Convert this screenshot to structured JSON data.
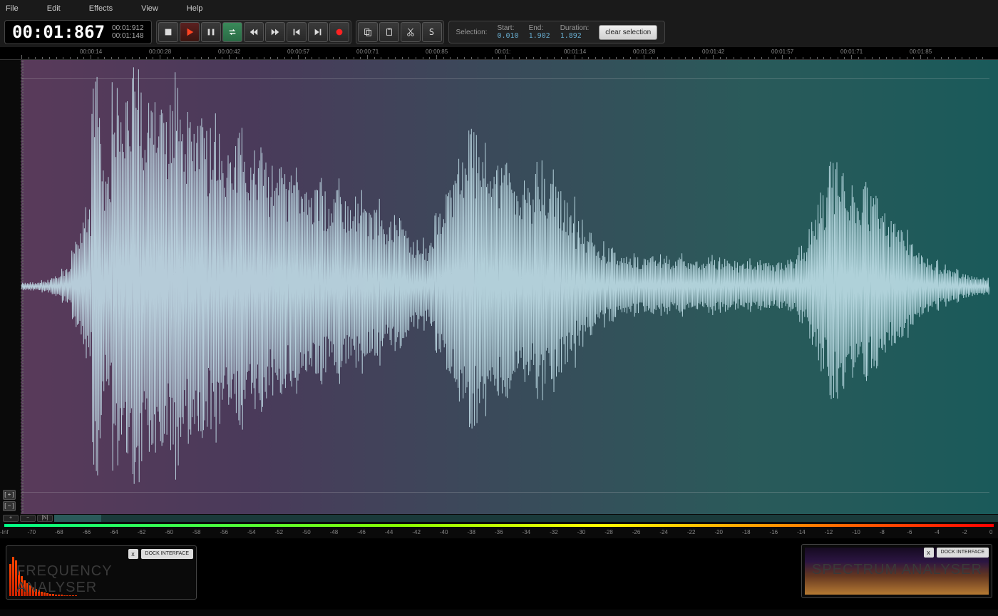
{
  "menu": {
    "file": "File",
    "edit": "Edit",
    "effects": "Effects",
    "view": "View",
    "help": "Help"
  },
  "time": {
    "main": "00:01:867",
    "sub1": "00:01:912",
    "sub2": "00:01:148"
  },
  "transport": {
    "snap": "S"
  },
  "selection": {
    "label": "Selection:",
    "start_label": "Start:",
    "start_val": "0.010",
    "end_label": "End:",
    "end_val": "1.902",
    "duration_label": "Duration:",
    "duration_val": "1.892",
    "clear": "clear selection"
  },
  "ruler": {
    "marks": [
      "00:00:14",
      "00:00:28",
      "00:00:42",
      "00:00:57",
      "00:00:71",
      "00:00:85",
      "00:01:",
      "00:01:14",
      "00:01:28",
      "00:01:42",
      "00:01:57",
      "00:01:71",
      "00:01:85"
    ]
  },
  "db_scale": {
    "marks": [
      "-Inf",
      "-70",
      "-68",
      "-66",
      "-64",
      "-62",
      "-60",
      "-58",
      "-56",
      "-54",
      "-52",
      "-50",
      "-48",
      "-46",
      "-44",
      "-42",
      "-40",
      "-38",
      "-36",
      "-34",
      "-32",
      "-30",
      "-28",
      "-26",
      "-24",
      "-22",
      "-20",
      "-18",
      "-16",
      "-14",
      "-12",
      "-10",
      "-8",
      "-6",
      "-4",
      "-2",
      "0"
    ]
  },
  "zoom": {
    "plus": "[ + ]",
    "minus": "[ − ]"
  },
  "bottom": {
    "plus": "+",
    "minus": "−",
    "fit": "[N]"
  },
  "panels": {
    "freq_title": "FREQUENCY ANALYSER",
    "spec_title": "SPECTRUM ANALYSER",
    "close": "x",
    "dock": "DOCK INTERFACE"
  }
}
